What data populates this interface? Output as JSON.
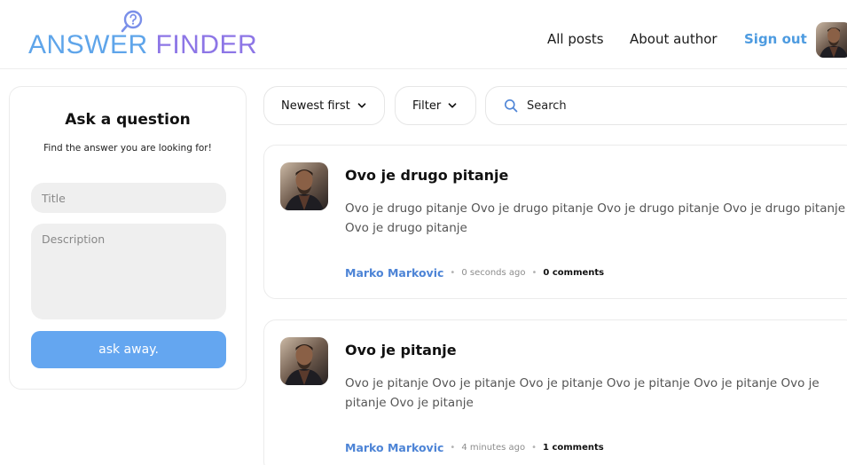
{
  "header": {
    "logo": {
      "part1": "ANSWER ",
      "part2": "FINDER"
    },
    "nav": {
      "all_posts": "All posts",
      "about_author": "About author",
      "sign_out": "Sign out"
    }
  },
  "ask": {
    "title": "Ask a question",
    "subtitle": "Find the answer you are looking for!",
    "title_placeholder": "Title",
    "description_placeholder": "Description",
    "submit_label": "ask away."
  },
  "toolbar": {
    "sort_label": "Newest first",
    "filter_label": "Filter",
    "search_placeholder": "Search"
  },
  "posts": [
    {
      "title": "Ovo je drugo pitanje",
      "body": "Ovo je drugo pitanje Ovo je drugo pitanje Ovo je drugo pitanje Ovo je drugo pitanje Ovo je drugo pitanje",
      "author": "Marko Markovic",
      "time": "0 seconds ago",
      "comments": "0 comments"
    },
    {
      "title": "Ovo je pitanje",
      "body": "Ovo je pitanje Ovo je pitanje Ovo je pitanje Ovo je pitanje Ovo je pitanje Ovo je pitanje Ovo je pitanje",
      "author": "Marko Markovic",
      "time": "4 minutes ago",
      "comments": "1 comments"
    }
  ],
  "meta_separator": "•",
  "colors": {
    "accent_blue": "#4d9be0",
    "button_blue": "#64a6f0",
    "author_blue": "#4d84d6",
    "logo_gradient_start": "#5fa5ea",
    "logo_gradient_end": "#8d76e6"
  },
  "icons": {
    "logo": "magnifier-question-icon",
    "sort": "chevron-down-icon",
    "filter": "chevron-down-icon",
    "search": "search-icon",
    "avatar": "user-avatar"
  }
}
